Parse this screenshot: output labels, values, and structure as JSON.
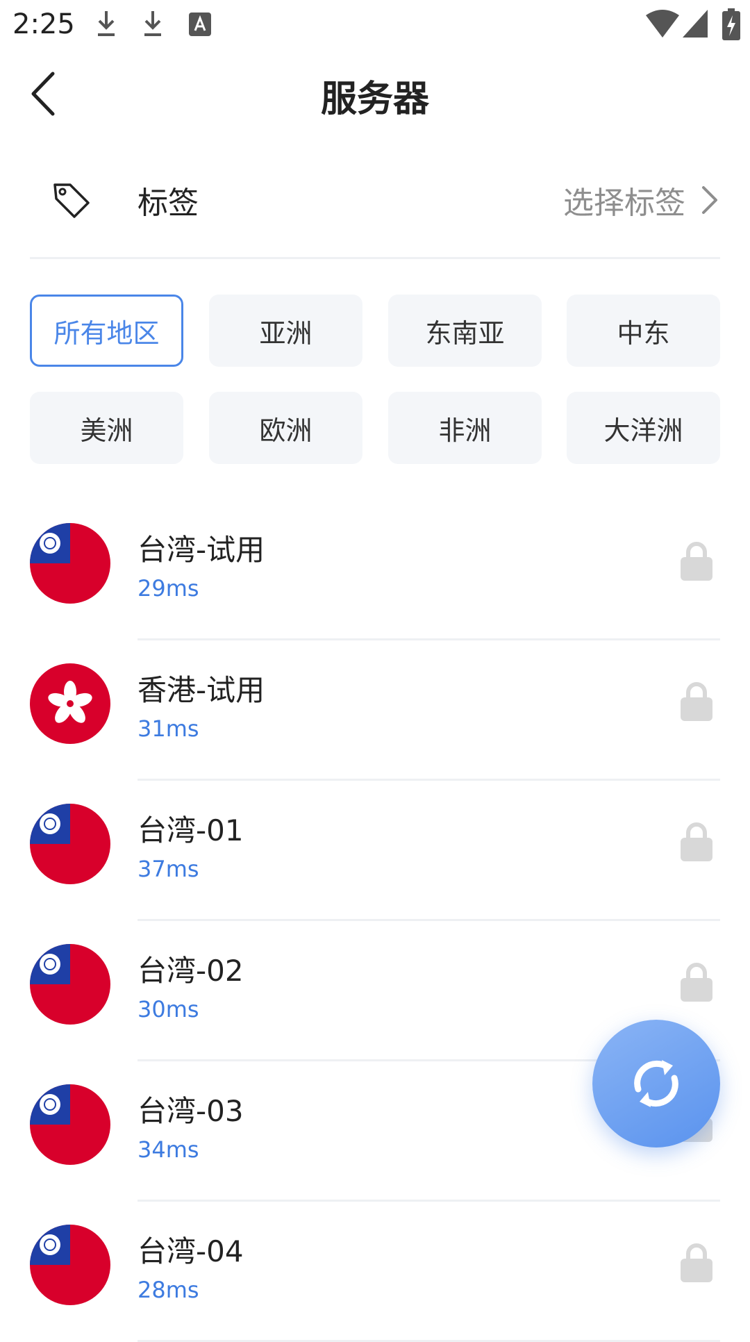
{
  "status_bar": {
    "time": "2:25"
  },
  "header": {
    "title": "服务器"
  },
  "tag": {
    "label": "标签",
    "value": "选择标签"
  },
  "regions": [
    {
      "label": "所有地区",
      "selected": true
    },
    {
      "label": "亚洲",
      "selected": false
    },
    {
      "label": "东南亚",
      "selected": false
    },
    {
      "label": "中东",
      "selected": false
    },
    {
      "label": "美洲",
      "selected": false
    },
    {
      "label": "欧洲",
      "selected": false
    },
    {
      "label": "非洲",
      "selected": false
    },
    {
      "label": "大洋洲",
      "selected": false
    }
  ],
  "servers": [
    {
      "name": "台湾-试用",
      "ping": "29ms",
      "flag": "taiwan-flag-icon",
      "locked": true
    },
    {
      "name": "香港-试用",
      "ping": "31ms",
      "flag": "hongkong-flag-icon",
      "locked": true
    },
    {
      "name": "台湾-01",
      "ping": "37ms",
      "flag": "taiwan-flag-icon",
      "locked": true
    },
    {
      "name": "台湾-02",
      "ping": "30ms",
      "flag": "taiwan-flag-icon",
      "locked": true
    },
    {
      "name": "台湾-03",
      "ping": "34ms",
      "flag": "taiwan-flag-icon",
      "locked": true
    },
    {
      "name": "台湾-04",
      "ping": "28ms",
      "flag": "taiwan-flag-icon",
      "locked": true
    }
  ],
  "colors": {
    "accent": "#4a86e8",
    "ping": "#3d7be0",
    "chip_bg": "#f4f6f9",
    "lock": "#d8d8d8",
    "flag_red": "#d8002b",
    "flag_blue": "#1f3fa6"
  }
}
